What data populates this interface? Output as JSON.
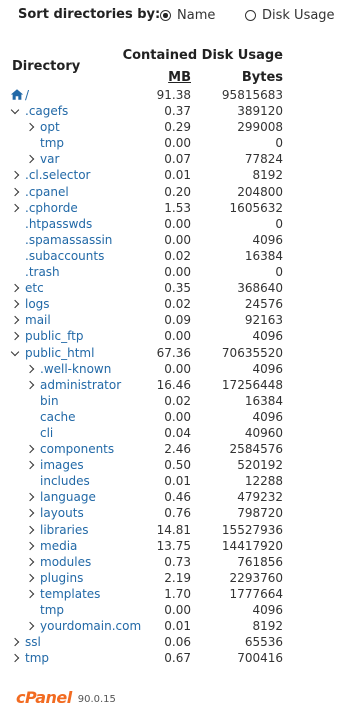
{
  "sort": {
    "label": "Sort directories by:",
    "options": [
      {
        "label": "Name",
        "checked": true
      },
      {
        "label": "Disk Usage",
        "checked": false
      }
    ]
  },
  "table": {
    "header_contained": "Contained Disk Usage",
    "header_directory": "Directory",
    "header_mb": "MB",
    "header_bytes": "Bytes",
    "rows": [
      {
        "name": "/",
        "depth": 0,
        "icon": "home-icon",
        "toggle": "none",
        "mb": "91.38",
        "bytes": "95815683"
      },
      {
        "name": ".cagefs",
        "depth": 0,
        "toggle": "open",
        "mb": "0.37",
        "bytes": "389120"
      },
      {
        "name": "opt",
        "depth": 1,
        "toggle": "closed",
        "mb": "0.29",
        "bytes": "299008"
      },
      {
        "name": "tmp",
        "depth": 1,
        "toggle": "none",
        "mb": "0.00",
        "bytes": "0"
      },
      {
        "name": "var",
        "depth": 1,
        "toggle": "closed",
        "mb": "0.07",
        "bytes": "77824"
      },
      {
        "name": ".cl.selector",
        "depth": 0,
        "toggle": "closed",
        "mb": "0.01",
        "bytes": "8192"
      },
      {
        "name": ".cpanel",
        "depth": 0,
        "toggle": "closed",
        "mb": "0.20",
        "bytes": "204800"
      },
      {
        "name": ".cphorde",
        "depth": 0,
        "toggle": "closed",
        "mb": "1.53",
        "bytes": "1605632"
      },
      {
        "name": ".htpasswds",
        "depth": 0,
        "toggle": "none",
        "mb": "0.00",
        "bytes": "0"
      },
      {
        "name": ".spamassassin",
        "depth": 0,
        "toggle": "none",
        "mb": "0.00",
        "bytes": "4096"
      },
      {
        "name": ".subaccounts",
        "depth": 0,
        "toggle": "none",
        "mb": "0.02",
        "bytes": "16384"
      },
      {
        "name": ".trash",
        "depth": 0,
        "toggle": "none",
        "mb": "0.00",
        "bytes": "0"
      },
      {
        "name": "etc",
        "depth": 0,
        "toggle": "closed",
        "mb": "0.35",
        "bytes": "368640"
      },
      {
        "name": "logs",
        "depth": 0,
        "toggle": "closed",
        "mb": "0.02",
        "bytes": "24576"
      },
      {
        "name": "mail",
        "depth": 0,
        "toggle": "closed",
        "mb": "0.09",
        "bytes": "92163"
      },
      {
        "name": "public_ftp",
        "depth": 0,
        "toggle": "closed",
        "mb": "0.00",
        "bytes": "4096"
      },
      {
        "name": "public_html",
        "depth": 0,
        "toggle": "open",
        "mb": "67.36",
        "bytes": "70635520"
      },
      {
        "name": ".well-known",
        "depth": 1,
        "toggle": "closed",
        "mb": "0.00",
        "bytes": "4096"
      },
      {
        "name": "administrator",
        "depth": 1,
        "toggle": "closed",
        "mb": "16.46",
        "bytes": "17256448"
      },
      {
        "name": "bin",
        "depth": 1,
        "toggle": "none",
        "mb": "0.02",
        "bytes": "16384"
      },
      {
        "name": "cache",
        "depth": 1,
        "toggle": "none",
        "mb": "0.00",
        "bytes": "4096"
      },
      {
        "name": "cli",
        "depth": 1,
        "toggle": "none",
        "mb": "0.04",
        "bytes": "40960"
      },
      {
        "name": "components",
        "depth": 1,
        "toggle": "closed",
        "mb": "2.46",
        "bytes": "2584576"
      },
      {
        "name": "images",
        "depth": 1,
        "toggle": "closed",
        "mb": "0.50",
        "bytes": "520192"
      },
      {
        "name": "includes",
        "depth": 1,
        "toggle": "none",
        "mb": "0.01",
        "bytes": "12288"
      },
      {
        "name": "language",
        "depth": 1,
        "toggle": "closed",
        "mb": "0.46",
        "bytes": "479232"
      },
      {
        "name": "layouts",
        "depth": 1,
        "toggle": "closed",
        "mb": "0.76",
        "bytes": "798720"
      },
      {
        "name": "libraries",
        "depth": 1,
        "toggle": "closed",
        "mb": "14.81",
        "bytes": "15527936"
      },
      {
        "name": "media",
        "depth": 1,
        "toggle": "closed",
        "mb": "13.75",
        "bytes": "14417920"
      },
      {
        "name": "modules",
        "depth": 1,
        "toggle": "closed",
        "mb": "0.73",
        "bytes": "761856"
      },
      {
        "name": "plugins",
        "depth": 1,
        "toggle": "closed",
        "mb": "2.19",
        "bytes": "2293760"
      },
      {
        "name": "templates",
        "depth": 1,
        "toggle": "closed",
        "mb": "1.70",
        "bytes": "1777664"
      },
      {
        "name": "tmp",
        "depth": 1,
        "toggle": "none",
        "mb": "0.00",
        "bytes": "4096"
      },
      {
        "name": "yourdomain.com",
        "depth": 1,
        "toggle": "closed",
        "mb": "0.01",
        "bytes": "8192"
      },
      {
        "name": "ssl",
        "depth": 0,
        "toggle": "closed",
        "mb": "0.06",
        "bytes": "65536"
      },
      {
        "name": "tmp",
        "depth": 0,
        "toggle": "closed",
        "mb": "0.67",
        "bytes": "700416"
      }
    ]
  },
  "footer": {
    "logo": "cPanel",
    "version": "90.0.15"
  },
  "colors": {
    "link": "#2269a7",
    "brand": "#f26b21"
  }
}
